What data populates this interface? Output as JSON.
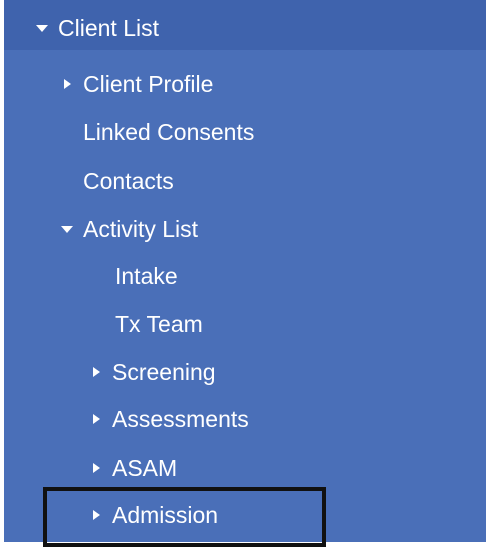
{
  "menu": {
    "client_list": "Client List",
    "client_profile": "Client Profile",
    "linked_consents": "Linked Consents",
    "contacts": "Contacts",
    "activity_list": "Activity List",
    "intake": "Intake",
    "tx_team": "Tx Team",
    "screening": "Screening",
    "assessments": "Assessments",
    "asam": "ASAM",
    "admission": "Admission"
  },
  "colors": {
    "panel_background": "#4a6fb8",
    "text": "#ffffff",
    "focus_outline": "#111111"
  },
  "icons": {
    "expanded": "triangle-down-icon",
    "collapsed": "triangle-right-icon"
  }
}
